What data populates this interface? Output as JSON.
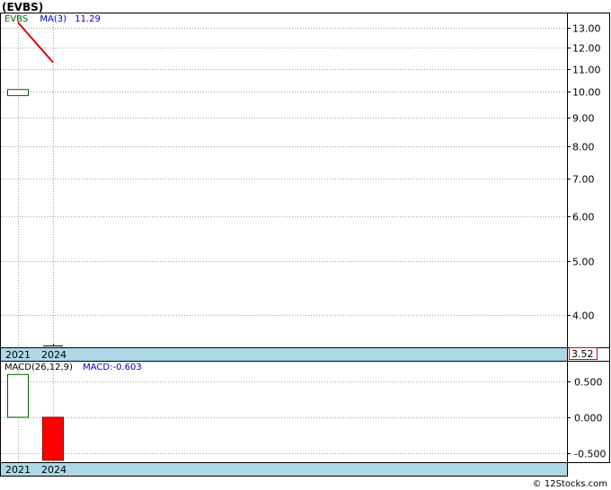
{
  "header": {
    "title": "(EVBS)"
  },
  "footer": {
    "copyright": "© 12Stocks.com"
  },
  "colors": {
    "background": "#ffffff",
    "frame": "#000000",
    "grid": "#a0a0a0",
    "axis_band": "#add8e6",
    "ticker_legend": "#006400",
    "ma_legend": "#0000cd",
    "ma_line": "#e00000",
    "candle_up": "#006400",
    "bar_positive": "#006400",
    "bar_negative": "#ff0000",
    "price_box": "#e60000"
  },
  "chart_data": [
    {
      "panel": "price",
      "type": "candlestick",
      "legend": {
        "ticker": "EVBS",
        "ma_label": "MA(3)",
        "ma_value": "11.29"
      },
      "x_labels": [
        "2021",
        "2024"
      ],
      "y_scale": "log",
      "y_ticks": [
        4.0,
        5.0,
        6.0,
        7.0,
        8.0,
        9.0,
        10.0,
        11.0,
        12.0,
        13.0
      ],
      "y_tick_labels": [
        "4.00",
        "5.00",
        "6.00",
        "7.00",
        "8.00",
        "9.00",
        "10.00",
        "11.00",
        "12.00",
        "13.00"
      ],
      "ylim": [
        3.52,
        13.8
      ],
      "candles": [
        {
          "x": "2021",
          "open": 9.85,
          "close": 10.1,
          "high": 10.1,
          "low": 9.85,
          "direction": "up"
        },
        {
          "x": "2024",
          "open": 3.52,
          "close": 3.52,
          "high": 3.52,
          "low": 3.52,
          "direction": "flat"
        }
      ],
      "ma_line": {
        "name": "MA(3)",
        "points": [
          {
            "x": "2021",
            "y": 13.3
          },
          {
            "x": "2024",
            "y": 11.29
          }
        ]
      },
      "last_price_label": "3.52",
      "grid": true
    },
    {
      "panel": "macd",
      "type": "bar",
      "legend": {
        "label": "MACD(26,12,9)",
        "value_label": "MACD:-0.603"
      },
      "x_labels": [
        "2021",
        "2024"
      ],
      "y_ticks": [
        0.5,
        0.0,
        -0.5
      ],
      "y_tick_labels": [
        "0.500",
        "0.000",
        "-0.500"
      ],
      "ylim": [
        -0.63,
        0.78
      ],
      "bars": [
        {
          "x": "2021",
          "value": 0.6,
          "style": "hollow-positive"
        },
        {
          "x": "2024",
          "value": -0.603,
          "style": "negative"
        }
      ],
      "grid": true
    }
  ]
}
